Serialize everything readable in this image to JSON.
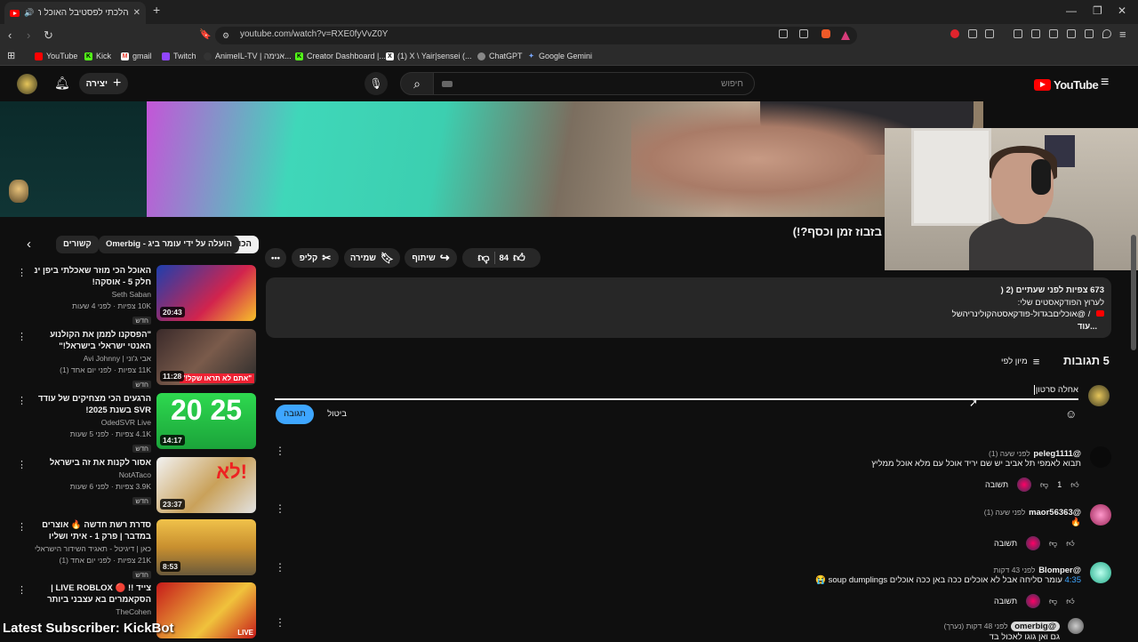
{
  "browser": {
    "tab_title": "הלכתי לפסטיבל האוכל האסיי",
    "url": "youtube.com/watch?v=RXE0fyVvZ0Y",
    "bookmarks": [
      "YouTube",
      "Kick",
      "gmail",
      "Twitch",
      "AnimeIL-TV | אנימה...",
      "Creator Dashboard |...",
      "(1) X \\ Yair|sensei (...",
      "ChatGPT",
      "Google Gemini"
    ]
  },
  "header": {
    "search_placeholder": "חיפוש",
    "create_label": "יצירה",
    "logo_text": "YouTube"
  },
  "video": {
    "title": "בזבוז זמן וכסף?!)"
  },
  "chips": [
    "הכול",
    "הועלה על ידי עומר ביג - Omerbig",
    "קשורים"
  ],
  "actions": {
    "like_count": "84",
    "share": "שיתוף",
    "save": "שמירה",
    "clip": "קליפ"
  },
  "description": {
    "line1": "673 צפיות  לפני שעתיים (2  (",
    "line2": "לערוץ הפודקאסטים שלי:",
    "line3": "/ @אוכליםבגדול-פודקאסטהקולינריהשל",
    "more": "...עוד"
  },
  "comments_section": {
    "count_label": "5 תגובות",
    "sort_label": "מיון לפי",
    "input_value": "אחלה סרטון",
    "cancel_label": "ביטול",
    "submit_label": "תגובה"
  },
  "comments": [
    {
      "author": "@peleg1111",
      "time": "לפני שעה (1)",
      "text": "תבוא לאמפי תל אביב יש שם יריד אוכל עם מלא אוכל ממליץ",
      "likes": "1",
      "reply": "תשובה"
    },
    {
      "author": "@maor56363",
      "time": "לפני שעה (1)",
      "text": "🔥",
      "likes": "",
      "reply": "תשובה"
    },
    {
      "author": "@Blomper",
      "time": "לפני 43 דקות",
      "timestamp": "4:35",
      "text": "עומר סליחה אבל לא אוכלים ככה באן ככה אוכלים soup dumplings 😭",
      "likes": "",
      "reply": "תשובה"
    },
    {
      "author": "@omerbig",
      "time": "לפני 48 דקות (נערך)",
      "text": "גם ואן גוגו לאכול בד"
    }
  ],
  "recommendations": [
    {
      "title": "האוכל הכי מוזר שאכלתי ביפן ינ חלק 5 - אוסקה!",
      "channel": "Seth Saban",
      "meta": "10K צפיות  · לפני 4 שעות",
      "badge": "חדש",
      "duration": "20:43"
    },
    {
      "title": "\"הפסקנו לממן את הקולנוע האנטי ישראלי בישראל!\"",
      "channel": "אבי ג'וני | Avi Johnny",
      "meta": "11K צפיות  · לפני יום אחד (1)",
      "badge": "חדש",
      "duration": "11:28"
    },
    {
      "title": "הרגעים הכי מצחיקים של עודד SVR בשנת 2025!",
      "channel": "OdedSVR Live",
      "meta": "4.1K צפיות  · לפני 5 שעות",
      "badge": "חדש",
      "duration": "14:17"
    },
    {
      "title": "אסור לקנות את זה בישראל",
      "channel": "NotATaco",
      "meta": "3.9K צפיות  · לפני 6 שעות",
      "badge": "חדש",
      "duration": "23:37"
    },
    {
      "title": "סדרת רשת חדשה 🔥 אוצרים במדבר | פרק 1 - איתי ושליו",
      "channel": "כאן | דיגיטל - תאגיד השידור הישראלי",
      "meta": "21K צפיות  · לפני יום אחד (1)",
      "badge": "חדש",
      "duration": "8:53"
    },
    {
      "title": "צייד !! 🔴 LIVE ROBLOX | הסקאמרים בא עצבני ביותר",
      "channel": "TheCohen",
      "meta": "",
      "badge": "",
      "duration": ""
    }
  ],
  "overlay": {
    "text": "Latest Subscriber: KickBot"
  },
  "colors": {
    "accent_red": "#ff0000",
    "submit_blue": "#3ea6ff",
    "bg": "#0f0f0f"
  }
}
